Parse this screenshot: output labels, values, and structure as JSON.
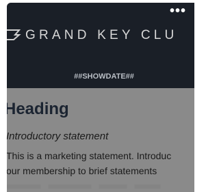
{
  "menu": {
    "more_label": "•••"
  },
  "header": {
    "brand_text": "GRAND KEY CLU",
    "showdate": "##SHOWDATE##",
    "logo_icon": "key-logo-icon",
    "background_color": "#1a1f27"
  },
  "content": {
    "heading": "Heading",
    "intro": "Introductory statement",
    "marketing_lines": [
      "This is a marketing statement. Introduc",
      "our membership to brief statements"
    ]
  },
  "colors": {
    "heading": "#1b2431",
    "overlay": "#8a8a8a"
  }
}
